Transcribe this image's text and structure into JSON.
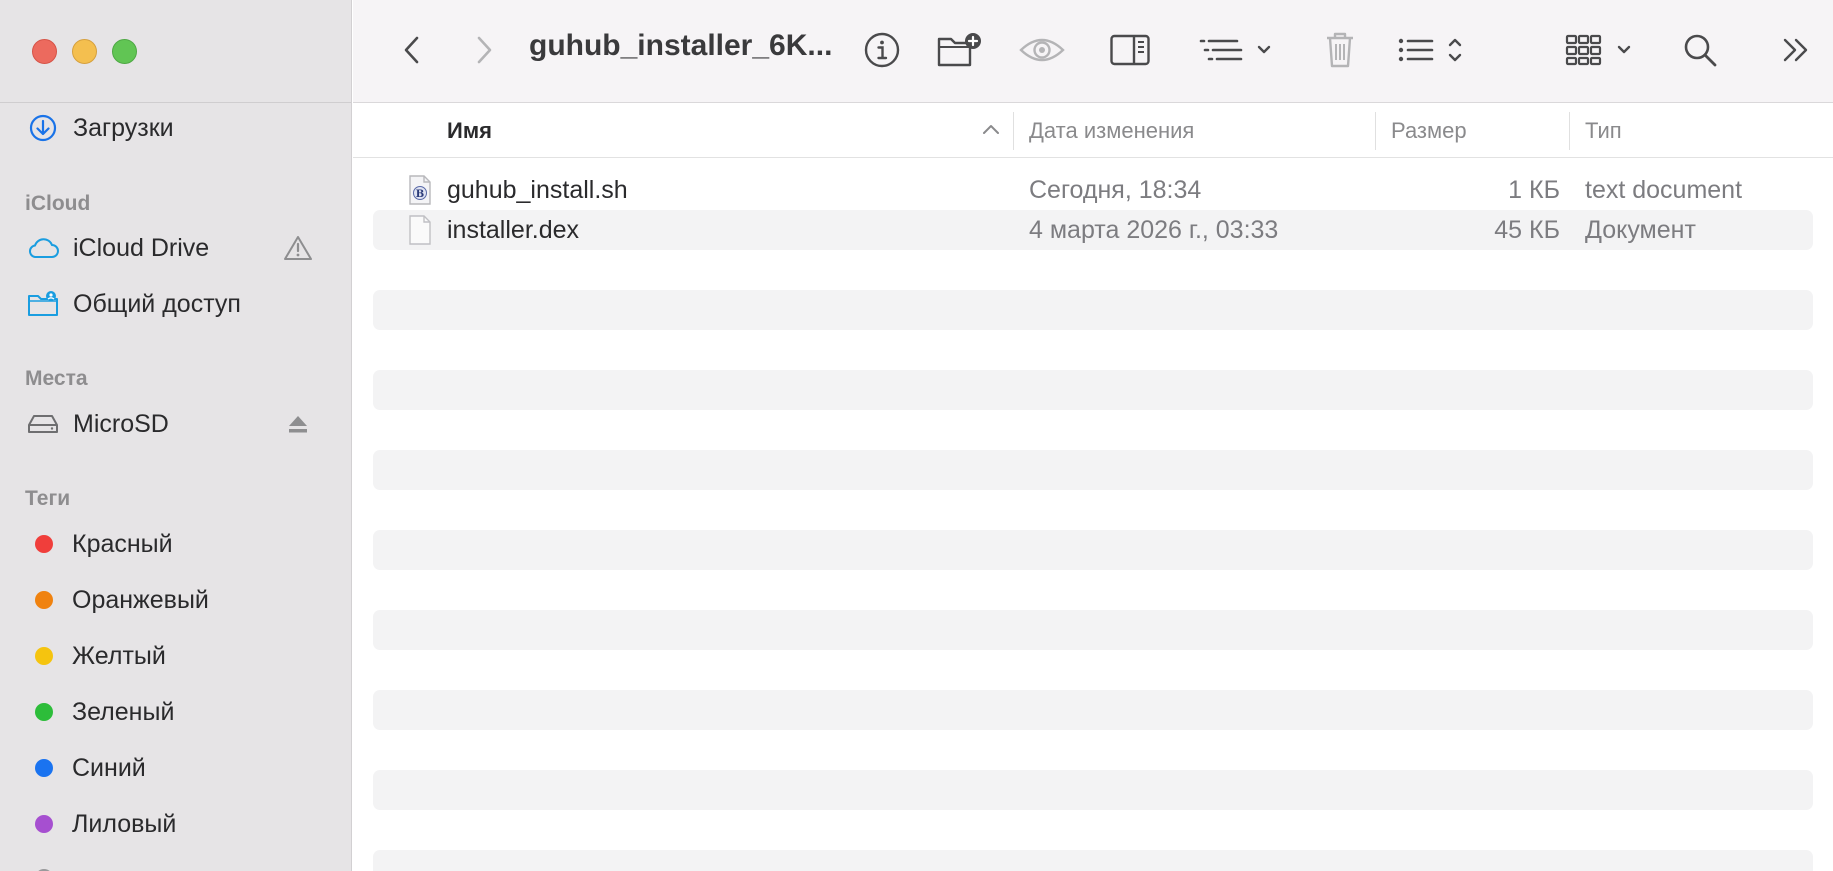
{
  "window": {
    "title": "guhub_installer_6K..."
  },
  "sidebar": {
    "top_item": {
      "label": "Загрузки",
      "icon": "download-circle-icon"
    },
    "sections": {
      "icloud": "iCloud",
      "places": "Места",
      "tags": "Теги"
    },
    "icloud_items": [
      {
        "label": "iCloud Drive",
        "icon": "cloud-icon",
        "status_icon": "warning-icon"
      },
      {
        "label": "Общий доступ",
        "icon": "shared-folder-icon"
      }
    ],
    "place_items": [
      {
        "label": "MicroSD",
        "icon": "drive-icon",
        "action_icon": "eject-icon"
      }
    ],
    "tags": [
      {
        "label": "Красный",
        "color": "#f03e3b"
      },
      {
        "label": "Оранжевый",
        "color": "#f0820f"
      },
      {
        "label": "Желтый",
        "color": "#f5c40f"
      },
      {
        "label": "Зеленый",
        "color": "#2dbd3a"
      },
      {
        "label": "Синий",
        "color": "#1a73f0"
      },
      {
        "label": "Лиловый",
        "color": "#a64fd0"
      }
    ]
  },
  "columns": {
    "name": "Имя",
    "date": "Дата изменения",
    "size": "Размер",
    "kind": "Тип"
  },
  "files": [
    {
      "name": "guhub_install.sh",
      "date": "Сегодня, 18:34",
      "size": "1 КБ",
      "kind": "text document",
      "icon": "script-file-icon"
    },
    {
      "name": "installer.dex",
      "date": "4 марта 2026 г., 03:33",
      "size": "45 КБ",
      "kind": "Документ",
      "icon": "blank-file-icon"
    }
  ]
}
